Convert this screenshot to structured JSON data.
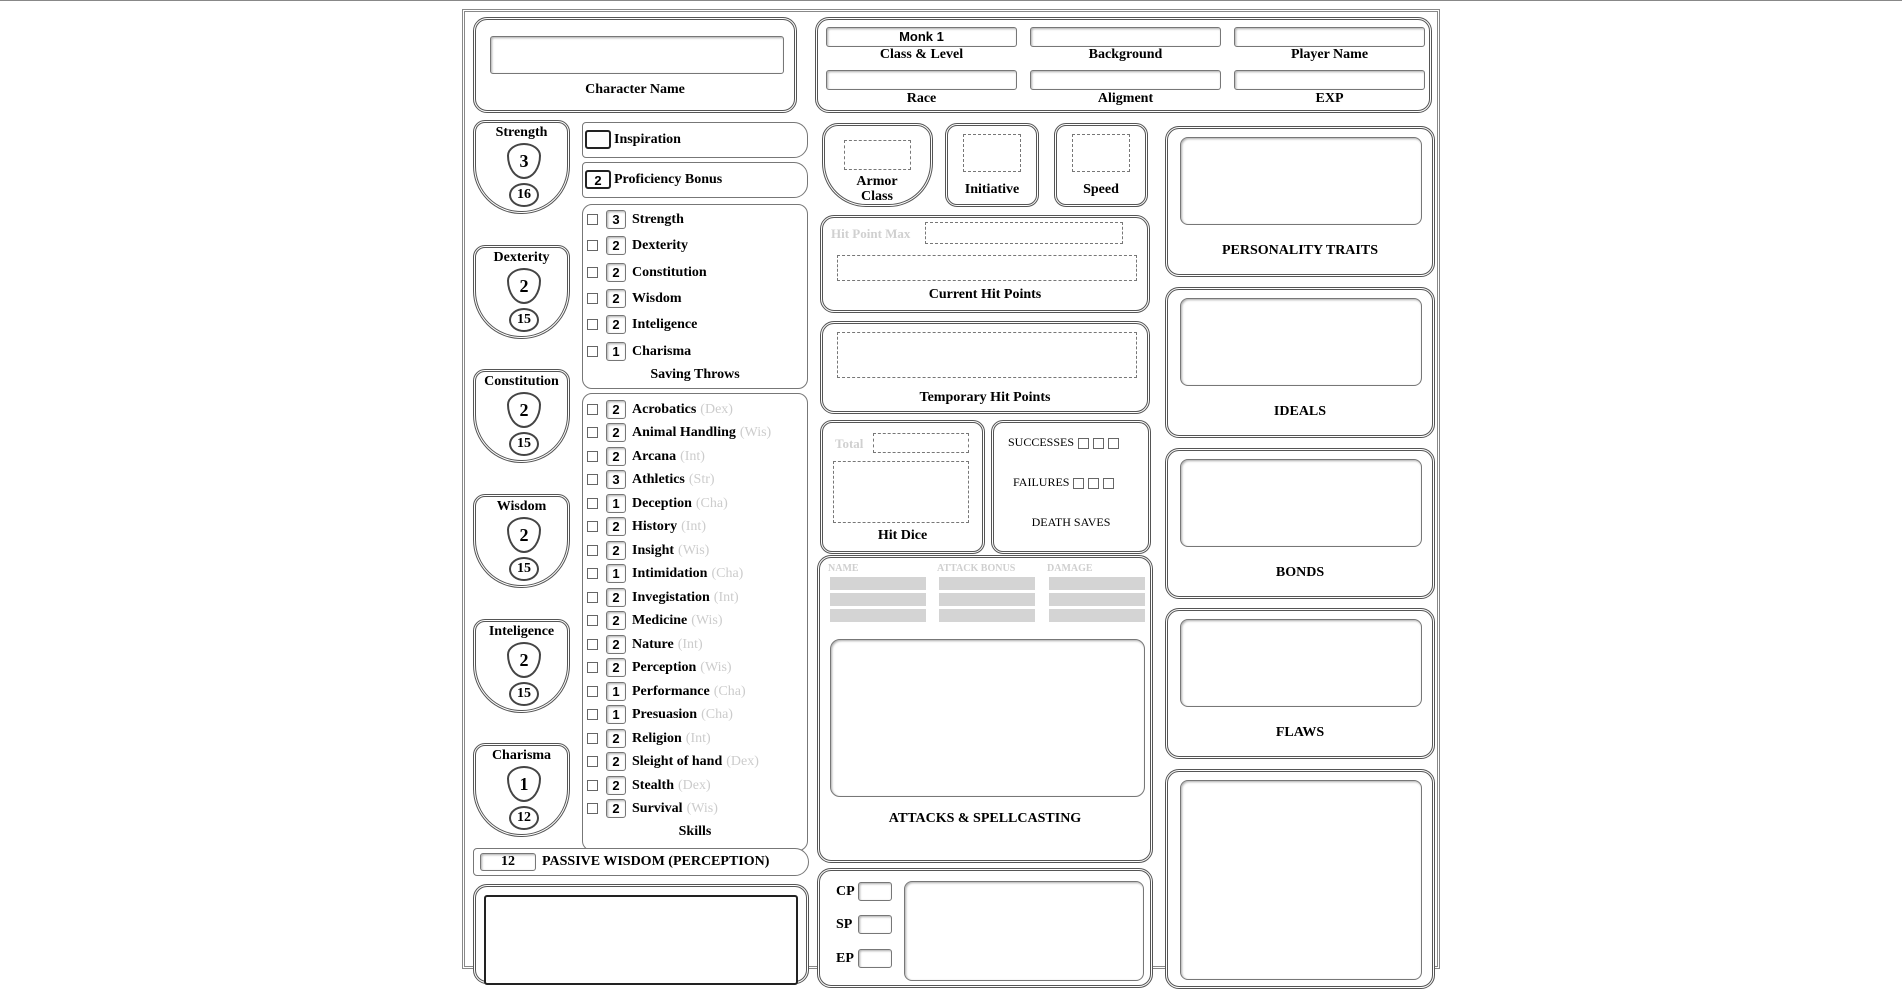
{
  "header": {
    "character_name_value": "",
    "character_name_label": "Character Name",
    "class_level_value": "Monk 1",
    "class_level_label": "Class & Level",
    "background_value": "",
    "background_label": "Background",
    "player_name_value": "",
    "player_name_label": "Player Name",
    "race_value": "",
    "race_label": "Race",
    "alignment_value": "",
    "alignment_label": "Aligment",
    "exp_value": "",
    "exp_label": "EXP"
  },
  "abilities": [
    {
      "name": "Strength",
      "mod": "3",
      "score": "16"
    },
    {
      "name": "Dexterity",
      "mod": "2",
      "score": "15"
    },
    {
      "name": "Constitution",
      "mod": "2",
      "score": "15"
    },
    {
      "name": "Wisdom",
      "mod": "2",
      "score": "15"
    },
    {
      "name": "Inteligence",
      "mod": "2",
      "score": "15"
    },
    {
      "name": "Charisma",
      "mod": "1",
      "score": "12"
    }
  ],
  "inspiration": {
    "value": "",
    "label": "Inspiration"
  },
  "proficiency": {
    "value": "2",
    "label": "Proficiency Bonus"
  },
  "saving_throws": {
    "label": "Saving Throws",
    "items": [
      {
        "value": "3",
        "name": "Strength"
      },
      {
        "value": "2",
        "name": "Dexterity"
      },
      {
        "value": "2",
        "name": "Constitution"
      },
      {
        "value": "2",
        "name": "Wisdom"
      },
      {
        "value": "2",
        "name": "Inteligence"
      },
      {
        "value": "1",
        "name": "Charisma"
      }
    ]
  },
  "skills": {
    "label": "Skills",
    "items": [
      {
        "value": "2",
        "name": "Acrobatics",
        "attr": "(Dex)"
      },
      {
        "value": "2",
        "name": "Animal Handling",
        "attr": "(Wis)"
      },
      {
        "value": "2",
        "name": "Arcana",
        "attr": "(Int)"
      },
      {
        "value": "3",
        "name": "Athletics",
        "attr": "(Str)"
      },
      {
        "value": "1",
        "name": "Deception",
        "attr": "(Cha)"
      },
      {
        "value": "2",
        "name": "History",
        "attr": "(Int)"
      },
      {
        "value": "2",
        "name": "Insight",
        "attr": "(Wis)"
      },
      {
        "value": "1",
        "name": "Intimidation",
        "attr": "(Cha)"
      },
      {
        "value": "2",
        "name": "Invegistation",
        "attr": "(Int)"
      },
      {
        "value": "2",
        "name": "Medicine",
        "attr": "(Wis)"
      },
      {
        "value": "2",
        "name": "Nature",
        "attr": "(Int)"
      },
      {
        "value": "2",
        "name": "Perception",
        "attr": "(Wis)"
      },
      {
        "value": "1",
        "name": "Performance",
        "attr": "(Cha)"
      },
      {
        "value": "1",
        "name": "Presuasion",
        "attr": "(Cha)"
      },
      {
        "value": "2",
        "name": "Religion",
        "attr": "(Int)"
      },
      {
        "value": "2",
        "name": "Sleight of hand",
        "attr": "(Dex)"
      },
      {
        "value": "2",
        "name": "Stealth",
        "attr": "(Dex)"
      },
      {
        "value": "2",
        "name": "Survival",
        "attr": "(Wis)"
      }
    ]
  },
  "passive": {
    "value": "12",
    "label": "PASSIVE WISDOM (PERCEPTION)"
  },
  "combat": {
    "armor_class_label": "Armor Class",
    "initiative_label": "Initiative",
    "speed_label": "Speed",
    "hp_max_label": "Hit Point Max",
    "current_hp_label": "Current Hit Points",
    "temp_hp_label": "Temporary Hit Points",
    "hit_dice_total_label": "Total",
    "hit_dice_label": "Hit Dice",
    "successes_label": "SUCCESSES",
    "failures_label": "FAILURES",
    "death_saves_label": "DEATH SAVES"
  },
  "attacks": {
    "col_name": "NAME",
    "col_bonus": "ATTACK BONUS",
    "col_damage": "DAMAGE",
    "label": "ATTACKS & SPELLCASTING"
  },
  "coins": [
    "CP",
    "SP",
    "EP"
  ],
  "traits": {
    "personality": "PERSONALITY TRAITS",
    "ideals": "IDEALS",
    "bonds": "BONDS",
    "flaws": "FLAWS"
  }
}
